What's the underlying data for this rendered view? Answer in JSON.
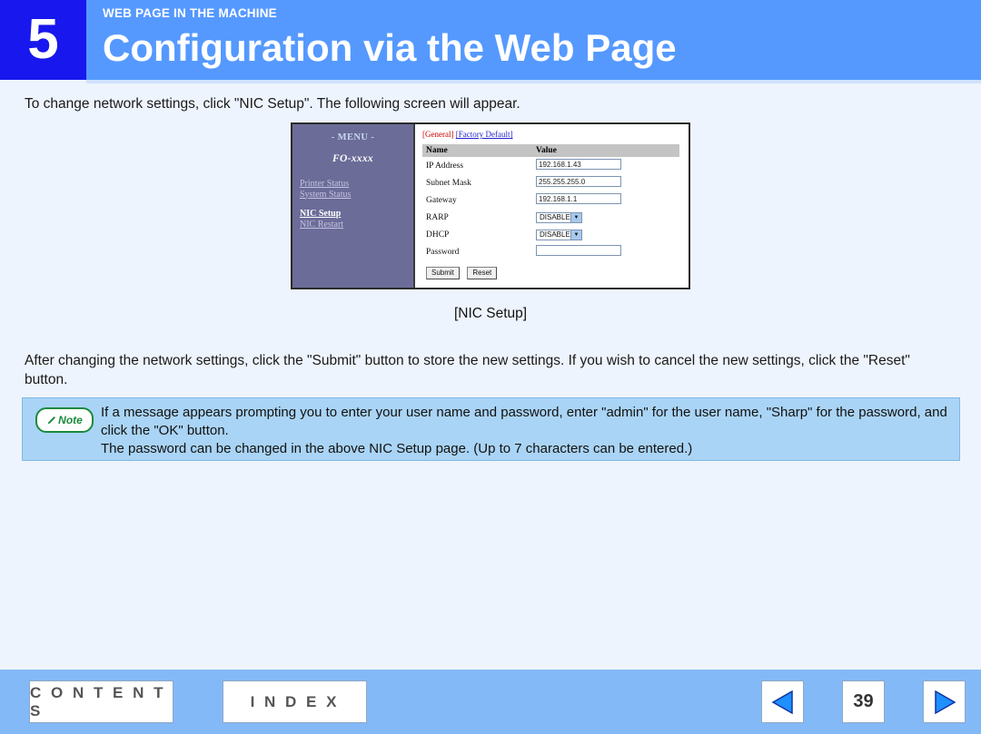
{
  "header": {
    "chapter_number": "5",
    "kicker": "WEB PAGE IN THE MACHINE",
    "title": "Configuration via the Web Page",
    "badge_color": "#1818ee",
    "bar_color": "#5599ff"
  },
  "body": {
    "intro_paragraph": "To change network settings, click \"NIC Setup\". The following screen will appear.",
    "figure_caption": "[NIC Setup]",
    "after_paragraph": "After changing the network settings, click the \"Submit\" button to store the new settings. If you wish to cancel the new settings, click the \"Reset\" button."
  },
  "screenshot": {
    "sidebar": {
      "menu_title": "- MENU -",
      "model": "FO-xxxx",
      "links": [
        {
          "label": "Printer Status",
          "current": false
        },
        {
          "label": "System Status",
          "current": false
        },
        {
          "label": "NIC Setup",
          "current": true
        },
        {
          "label": "NIC Restart",
          "current": false
        }
      ]
    },
    "toplinks": {
      "current": "[General]",
      "other": "[Factory Default]"
    },
    "table": {
      "headers": [
        "Name",
        "Value"
      ],
      "rows": [
        {
          "name": "IP Address",
          "type": "text",
          "value": "192.168.1.43"
        },
        {
          "name": "Subnet Mask",
          "type": "text",
          "value": "255.255.255.0"
        },
        {
          "name": "Gateway",
          "type": "text",
          "value": "192.168.1.1"
        },
        {
          "name": "RARP",
          "type": "select",
          "value": "DISABLE"
        },
        {
          "name": "DHCP",
          "type": "select",
          "value": "DISABLE"
        },
        {
          "name": "Password",
          "type": "text",
          "value": ""
        }
      ]
    },
    "buttons": {
      "submit": "Submit",
      "reset": "Reset"
    }
  },
  "note": {
    "badge_label": "Note",
    "badge_icon": "pencil-icon",
    "badge_color": "#1a8a3c",
    "box_color": "#aad4f5",
    "line1": "If a message appears prompting you to enter your user name and password, enter \"admin\" for the user name, \"Sharp\" for the password, and click the \"OK\" button.",
    "line2": "The password can be changed in the above NIC Setup page. (Up to 7 characters can be entered.)"
  },
  "footer": {
    "contents_label": "C O N T E N T S",
    "index_label": "I N D E X",
    "page_number": "39",
    "prev_icon": "triangle-left-icon",
    "next_icon": "triangle-right-icon",
    "bar_color": "#83b9f7"
  }
}
